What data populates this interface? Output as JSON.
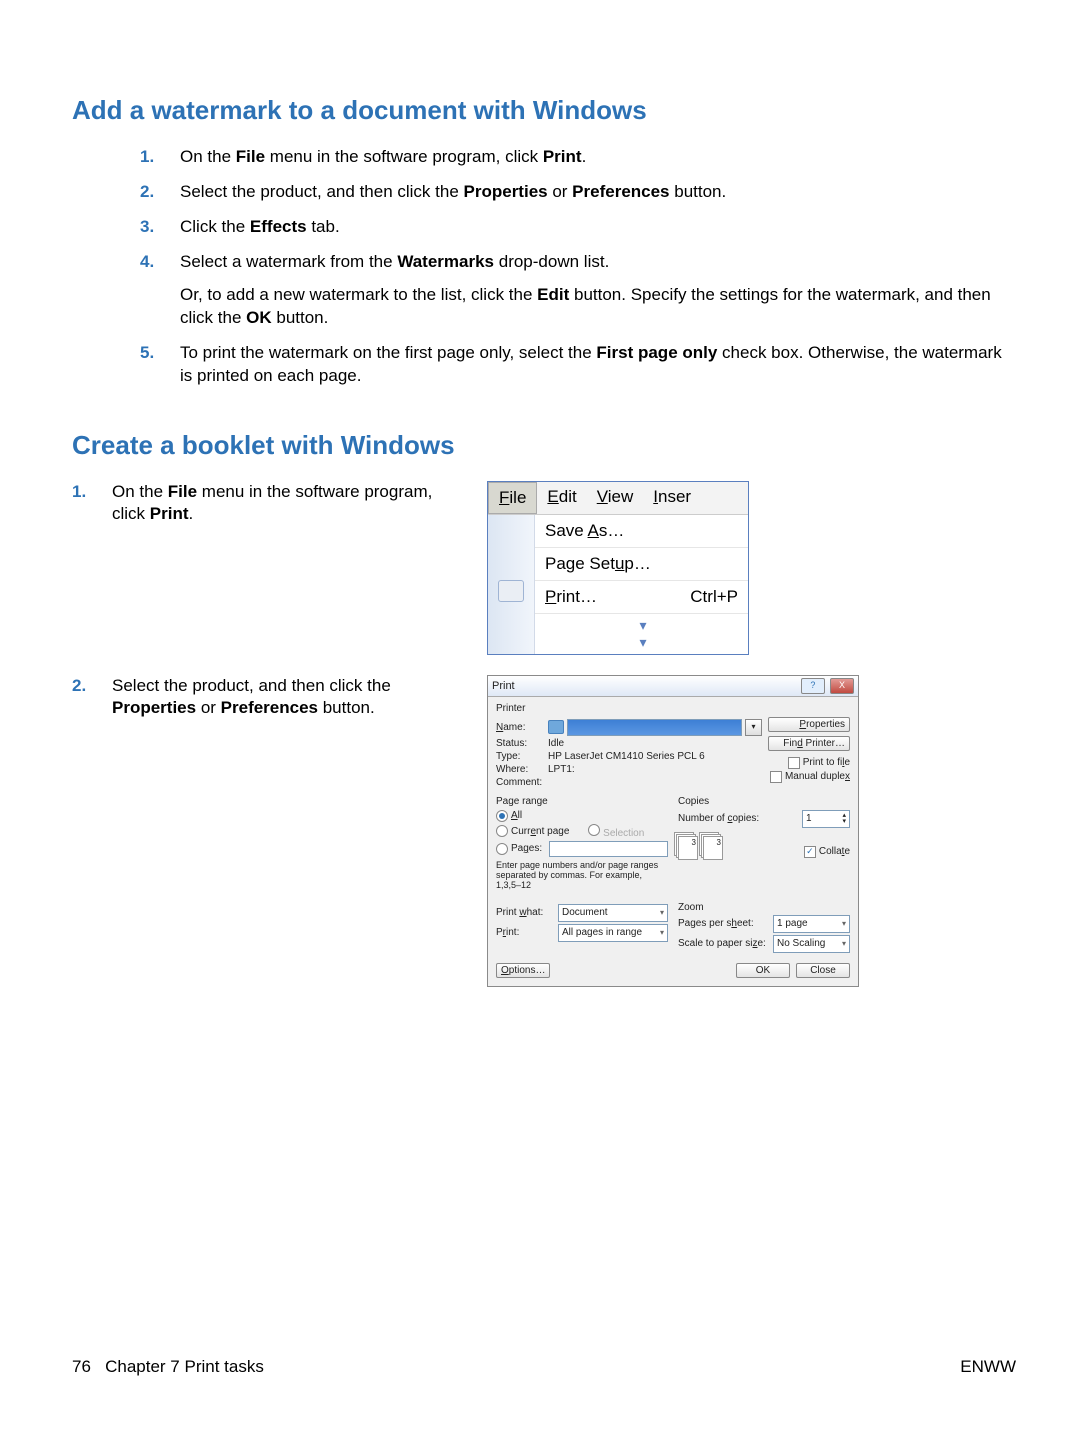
{
  "section1": {
    "heading": "Add a watermark to a document with Windows",
    "steps": {
      "s1": {
        "n": "1.",
        "pre": "On the ",
        "b1": "File",
        "mid": " menu in the software program, click ",
        "b2": "Print",
        "post": "."
      },
      "s2": {
        "n": "2.",
        "pre": "Select the product, and then click the ",
        "b1": "Properties",
        "mid": " or ",
        "b2": "Preferences",
        "post": " button."
      },
      "s3": {
        "n": "3.",
        "pre": "Click the ",
        "b1": "Effects",
        "post": " tab."
      },
      "s4": {
        "n": "4.",
        "pre": "Select a watermark from the ",
        "b1": "Watermarks",
        "post": " drop-down list.",
        "sub_pre": "Or, to add a new watermark to the list, click the ",
        "sub_b1": "Edit",
        "sub_mid": " button. Specify the settings for the watermark, and then click the ",
        "sub_b2": "OK",
        "sub_post": " button."
      },
      "s5": {
        "n": "5.",
        "pre": "To print the watermark on the first page only, select the ",
        "b1": "First page only",
        "post": " check box. Otherwise, the watermark is printed on each page."
      }
    }
  },
  "section2": {
    "heading": "Create a booklet with Windows",
    "step1": {
      "n": "1.",
      "pre": "On the ",
      "b1": "File",
      "mid": " menu in the software program, click ",
      "b2": "Print",
      "post": "."
    },
    "step2": {
      "n": "2.",
      "pre": "Select the product, and then click the ",
      "b1": "Properties",
      "mid": " or ",
      "b2": "Preferences",
      "post": " button."
    }
  },
  "filemenu": {
    "file": "File",
    "edit": "Edit",
    "view": "View",
    "inser": "Inser",
    "saveas": "Save As…",
    "pagesetup": "Page Setup…",
    "print": "Print…",
    "shortcut": "Ctrl+P",
    "expand": "▾▾▾"
  },
  "dlg": {
    "title": "Print",
    "help": "?",
    "close": "X",
    "printer": {
      "legend": "Printer",
      "name_lbl": "Name:",
      "status_lbl": "Status:",
      "status": "Idle",
      "type_lbl": "Type:",
      "type": "HP LaserJet CM1410 Series PCL 6",
      "where_lbl": "Where:",
      "where": "LPT1:",
      "comment_lbl": "Comment:",
      "properties": "Properties",
      "find": "Find Printer…",
      "ptf": "Print to file",
      "mdx": "Manual duplex"
    },
    "range": {
      "legend": "Page range",
      "all": "All",
      "current": "Current page",
      "selection": "Selection",
      "pages": "Pages:",
      "hint": "Enter page numbers and/or page ranges separated by commas. For example, 1,3,5–12"
    },
    "copies": {
      "legend": "Copies",
      "num_lbl": "Number of copies:",
      "num": "1",
      "collate": "Collate",
      "ic1": "3",
      "ic2": "3"
    },
    "what": {
      "lbl": "Print what:",
      "val": "Document"
    },
    "printsel": {
      "lbl": "Print:",
      "val": "All pages in range"
    },
    "zoom": {
      "legend": "Zoom",
      "pps_lbl": "Pages per sheet:",
      "pps": "1 page",
      "scale_lbl": "Scale to paper size:",
      "scale": "No Scaling"
    },
    "options": "Options…",
    "ok": "OK",
    "closebtn": "Close"
  },
  "footer": {
    "page": "76",
    "chapter": "Chapter 7   Print tasks",
    "right": "ENWW"
  }
}
